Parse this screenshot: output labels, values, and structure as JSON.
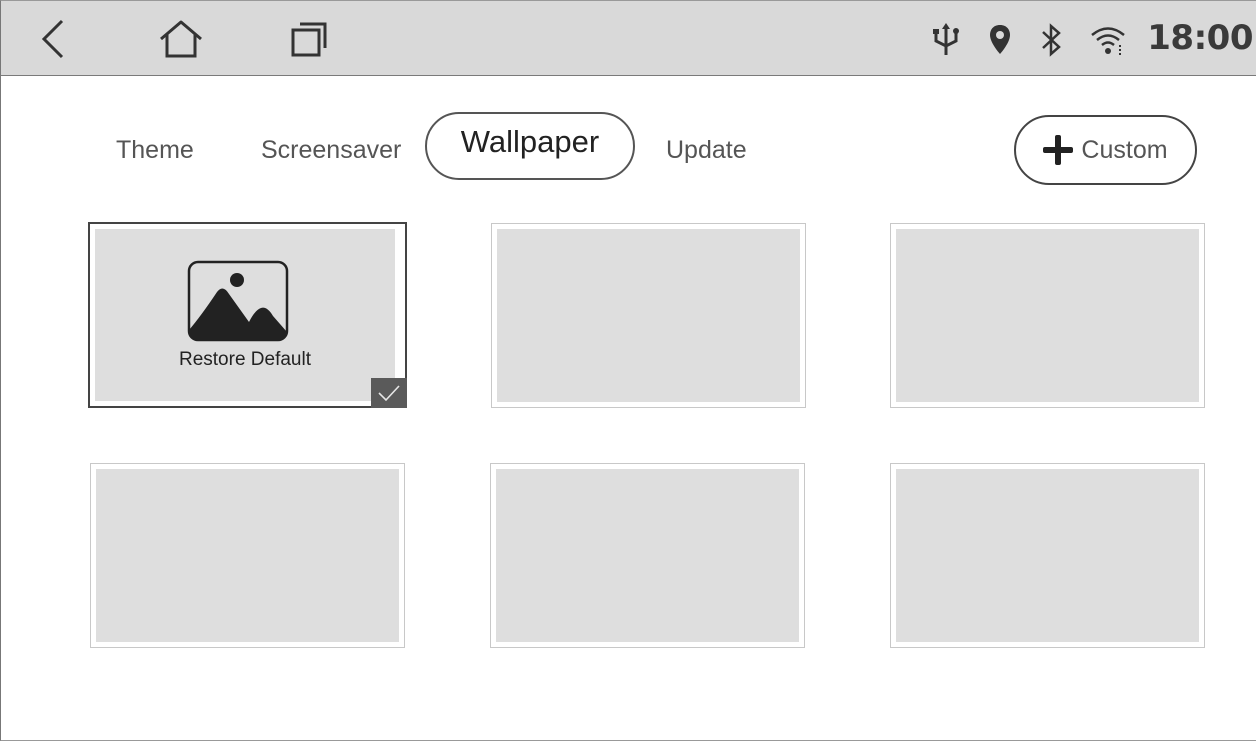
{
  "status_bar": {
    "time": "18:00",
    "icons": [
      "usb-icon",
      "location-pin-icon",
      "bluetooth-icon",
      "wifi-icon"
    ],
    "nav": [
      "back-icon",
      "home-icon",
      "recent-apps-icon"
    ]
  },
  "tabs": [
    {
      "label": "Theme"
    },
    {
      "label": "Screensaver"
    },
    {
      "label": "Wallpaper"
    },
    {
      "label": "Update"
    }
  ],
  "active_tab": "Wallpaper",
  "custom_button": {
    "label": "Custom",
    "icon": "plus-icon"
  },
  "wallpapers": [
    {
      "label": "Restore Default",
      "selected": true,
      "icon": "image-icon"
    },
    {
      "label": "",
      "selected": false
    },
    {
      "label": "",
      "selected": false
    },
    {
      "label": "",
      "selected": false
    },
    {
      "label": "",
      "selected": false
    },
    {
      "label": "",
      "selected": false
    }
  ],
  "colors": {
    "status_bar_bg": "#d9d9d9",
    "thumbnail_bg": "#dedede",
    "check_badge_bg": "#5a5a5a"
  }
}
